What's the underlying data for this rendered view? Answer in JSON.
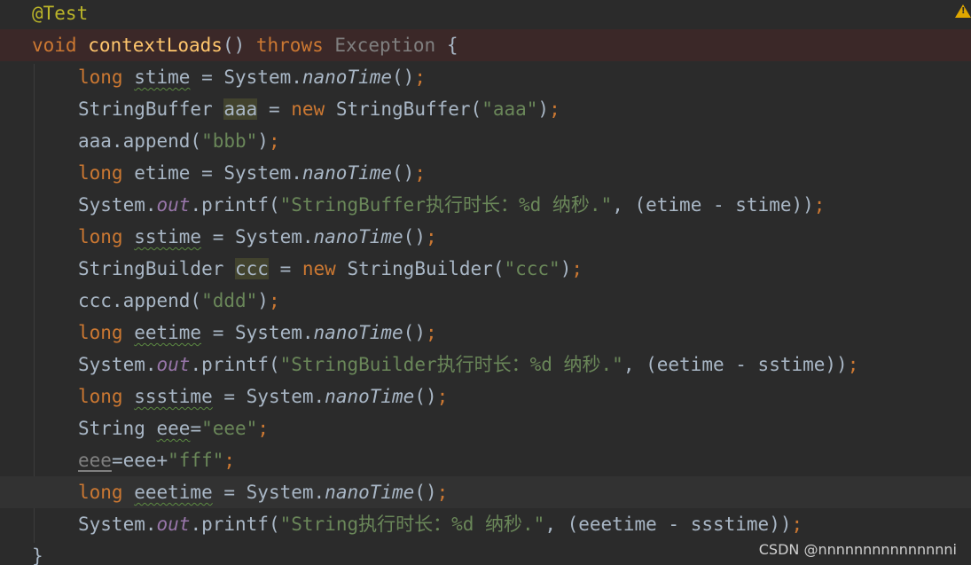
{
  "lines": [
    {
      "tokens": [
        {
          "t": "@Test",
          "c": "t-ann"
        }
      ]
    },
    {
      "tokens": [
        {
          "t": "void ",
          "c": "t-kw"
        },
        {
          "t": "contextLoads",
          "c": "t-fn"
        },
        {
          "t": "() "
        },
        {
          "t": "throws ",
          "c": "t-kw"
        },
        {
          "t": "Exception ",
          "c": "t-gray"
        },
        {
          "t": "{"
        }
      ]
    },
    {
      "tokens": [
        {
          "t": "long ",
          "c": "t-kw"
        },
        {
          "t": "stime",
          "c": "t-sq"
        },
        {
          "t": " = System."
        },
        {
          "t": "nanoTime",
          "c": "t-staticm"
        },
        {
          "t": "()"
        },
        {
          "t": ";",
          "c": "t-kw"
        }
      ]
    },
    {
      "tokens": [
        {
          "t": "StringBuffer "
        },
        {
          "t": "aaa",
          "c": "t-ident-hl"
        },
        {
          "t": " = "
        },
        {
          "t": "new ",
          "c": "t-kw"
        },
        {
          "t": "StringBuffer("
        },
        {
          "t": "\"aaa\"",
          "c": "t-str"
        },
        {
          "t": ")"
        },
        {
          "t": ";",
          "c": "t-kw"
        }
      ]
    },
    {
      "tokens": [
        {
          "t": "aaa.append("
        },
        {
          "t": "\"bbb\"",
          "c": "t-str"
        },
        {
          "t": ")"
        },
        {
          "t": ";",
          "c": "t-kw"
        }
      ]
    },
    {
      "tokens": [
        {
          "t": "long ",
          "c": "t-kw"
        },
        {
          "t": "etime = System."
        },
        {
          "t": "nanoTime",
          "c": "t-staticm"
        },
        {
          "t": "()"
        },
        {
          "t": ";",
          "c": "t-kw"
        }
      ]
    },
    {
      "tokens": [
        {
          "t": "System."
        },
        {
          "t": "out",
          "c": "t-static"
        },
        {
          "t": ".printf("
        },
        {
          "t": "\"StringBuffer执行时长：%d 纳秒.\"",
          "c": "t-str"
        },
        {
          "t": ", (etime - stime))"
        },
        {
          "t": ";",
          "c": "t-kw"
        }
      ]
    },
    {
      "tokens": [
        {
          "t": "long ",
          "c": "t-kw"
        },
        {
          "t": "sstime",
          "c": "t-sq"
        },
        {
          "t": " = System."
        },
        {
          "t": "nanoTime",
          "c": "t-staticm"
        },
        {
          "t": "()"
        },
        {
          "t": ";",
          "c": "t-kw"
        }
      ]
    },
    {
      "tokens": [
        {
          "t": "StringBuilder "
        },
        {
          "t": "ccc",
          "c": "t-ident-hl"
        },
        {
          "t": " = "
        },
        {
          "t": "new ",
          "c": "t-kw"
        },
        {
          "t": "StringBuilder("
        },
        {
          "t": "\"ccc\"",
          "c": "t-str"
        },
        {
          "t": ")"
        },
        {
          "t": ";",
          "c": "t-kw"
        }
      ]
    },
    {
      "tokens": [
        {
          "t": "ccc.append("
        },
        {
          "t": "\"ddd\"",
          "c": "t-str"
        },
        {
          "t": ")"
        },
        {
          "t": ";",
          "c": "t-kw"
        }
      ]
    },
    {
      "tokens": [
        {
          "t": "long ",
          "c": "t-kw"
        },
        {
          "t": "eetime",
          "c": "t-sq"
        },
        {
          "t": " = System."
        },
        {
          "t": "nanoTime",
          "c": "t-staticm"
        },
        {
          "t": "()"
        },
        {
          "t": ";",
          "c": "t-kw"
        }
      ]
    },
    {
      "tokens": [
        {
          "t": "System."
        },
        {
          "t": "out",
          "c": "t-static"
        },
        {
          "t": ".printf("
        },
        {
          "t": "\"StringBuilder执行时长：%d 纳秒.\"",
          "c": "t-str"
        },
        {
          "t": ", (eetime - sstime))"
        },
        {
          "t": ";",
          "c": "t-kw"
        }
      ]
    },
    {
      "tokens": [
        {
          "t": "long ",
          "c": "t-kw"
        },
        {
          "t": "ssstime",
          "c": "t-sq"
        },
        {
          "t": " = System."
        },
        {
          "t": "nanoTime",
          "c": "t-staticm"
        },
        {
          "t": "()"
        },
        {
          "t": ";",
          "c": "t-kw"
        }
      ]
    },
    {
      "tokens": [
        {
          "t": "String "
        },
        {
          "t": "eee",
          "c": "t-sq"
        },
        {
          "t": "="
        },
        {
          "t": "\"eee\"",
          "c": "t-str"
        },
        {
          "t": ";",
          "c": "t-kw"
        }
      ]
    },
    {
      "tokens": [
        {
          "t": "eee",
          "c": "t-dim"
        },
        {
          "t": "=eee+"
        },
        {
          "t": "\"fff\"",
          "c": "t-str"
        },
        {
          "t": ";",
          "c": "t-kw"
        }
      ]
    },
    {
      "tokens": [
        {
          "t": "long ",
          "c": "t-kw"
        },
        {
          "t": "eeetime",
          "c": "t-sq"
        },
        {
          "t": " = System."
        },
        {
          "t": "nanoTime",
          "c": "t-staticm"
        },
        {
          "t": "()"
        },
        {
          "t": ";",
          "c": "t-kw"
        }
      ]
    },
    {
      "tokens": [
        {
          "t": "System."
        },
        {
          "t": "out",
          "c": "t-static"
        },
        {
          "t": ".printf("
        },
        {
          "t": "\"String执行时长：%d 纳秒.\"",
          "c": "t-str"
        },
        {
          "t": ", (eeetime - ssstime))"
        },
        {
          "t": ";",
          "c": "t-kw"
        }
      ]
    },
    {
      "tokens": [
        {
          "t": "}"
        }
      ]
    }
  ],
  "colors": {
    "background": "#2b2b2b",
    "keyword": "#cc7832",
    "annotation": "#bbb529",
    "method_decl": "#ffc66d",
    "string": "#6a8759",
    "static_field": "#9876aa",
    "default_text": "#a9b7c6"
  },
  "gutter": {
    "warning_icon": "warning-triangle-icon"
  },
  "watermark": "CSDN @nnnnnnnnnnnnnnni"
}
